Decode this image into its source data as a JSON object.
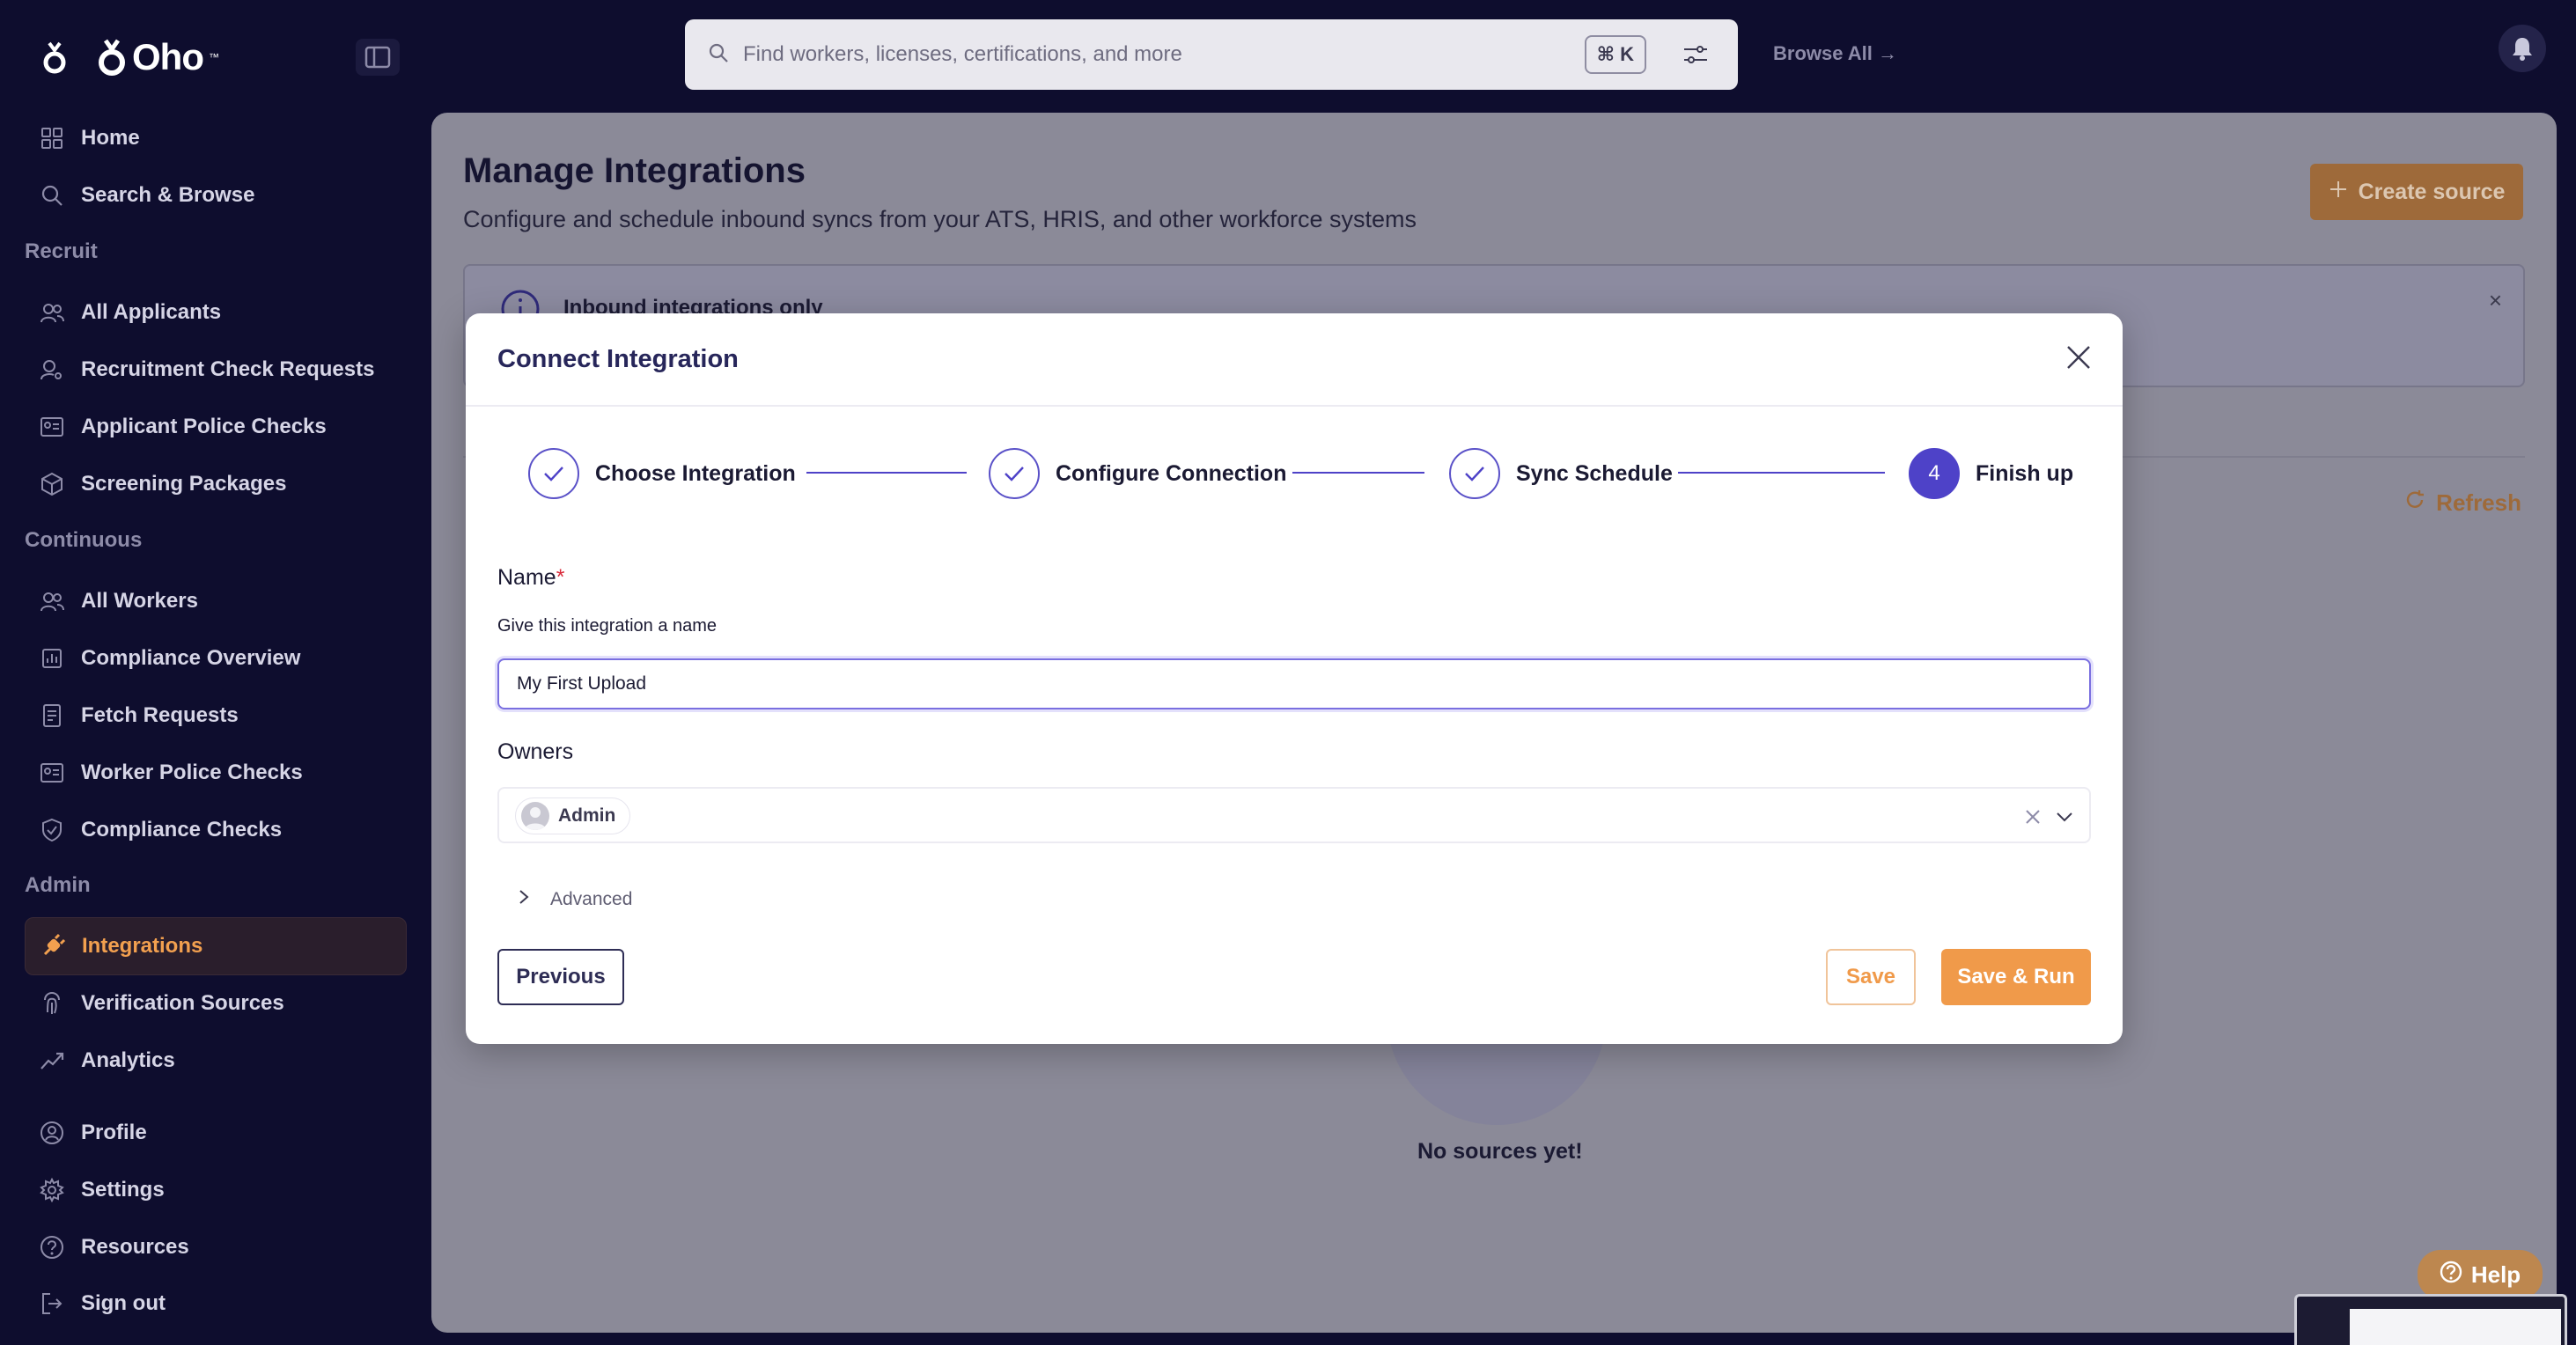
{
  "app": {
    "brand": "Oho",
    "brand_tm": "™"
  },
  "topbar": {
    "search_placeholder": "Find workers, licenses, certifications, and more",
    "shortcut": "⌘ K",
    "browse_all": "Browse All →"
  },
  "sidebar": {
    "items_top": [
      {
        "label": "Home",
        "icon": "grid-icon"
      },
      {
        "label": "Search & Browse",
        "icon": "search-icon"
      }
    ],
    "sections": {
      "recruit": "Recruit",
      "continuous": "Continuous",
      "admin": "Admin"
    },
    "recruit_items": [
      {
        "label": "All Applicants",
        "icon": "users-icon"
      },
      {
        "label": "Recruitment Check Requests",
        "icon": "user-search-icon"
      },
      {
        "label": "Applicant Police Checks",
        "icon": "id-card-icon"
      },
      {
        "label": "Screening Packages",
        "icon": "package-icon"
      }
    ],
    "continuous_items": [
      {
        "label": "All Workers",
        "icon": "users-icon"
      },
      {
        "label": "Compliance Overview",
        "icon": "bar-chart-icon"
      },
      {
        "label": "Fetch Requests",
        "icon": "document-icon"
      },
      {
        "label": "Worker Police Checks",
        "icon": "id-card-icon"
      },
      {
        "label": "Compliance Checks",
        "icon": "shield-check-icon"
      }
    ],
    "admin_items": [
      {
        "label": "Integrations",
        "icon": "plug-icon",
        "active": true
      },
      {
        "label": "Verification Sources",
        "icon": "fingerprint-icon"
      },
      {
        "label": "Analytics",
        "icon": "trend-icon"
      }
    ],
    "bottom_items": [
      {
        "label": "Profile",
        "icon": "user-circle-icon"
      },
      {
        "label": "Settings",
        "icon": "gear-icon"
      },
      {
        "label": "Resources",
        "icon": "help-circle-icon"
      },
      {
        "label": "Sign out",
        "icon": "sign-out-icon"
      }
    ]
  },
  "page": {
    "title": "Manage Integrations",
    "subtitle": "Configure and schedule inbound syncs from your ATS, HRIS, and other workforce systems",
    "create_button": "Create source",
    "banner_title": "Inbound integrations only",
    "refresh": "Refresh",
    "empty_state": "No sources yet!",
    "help": "Help"
  },
  "modal": {
    "title": "Connect Integration",
    "steps": [
      {
        "label": "Choose Integration",
        "state": "done"
      },
      {
        "label": "Configure Connection",
        "state": "done"
      },
      {
        "label": "Sync Schedule",
        "state": "done"
      },
      {
        "label": "Finish up",
        "state": "current",
        "number": "4"
      }
    ],
    "name_label": "Name",
    "name_required": "*",
    "name_help": "Give this integration a name",
    "name_value": "My First Upload",
    "owners_label": "Owners",
    "owner_chip": "Admin",
    "advanced": "Advanced",
    "previous": "Previous",
    "save": "Save",
    "save_run": "Save & Run"
  },
  "colors": {
    "sidebar_bg": "#0e0d2e",
    "accent_orange": "#f09a4a",
    "accent_purple": "#4e42c8"
  }
}
